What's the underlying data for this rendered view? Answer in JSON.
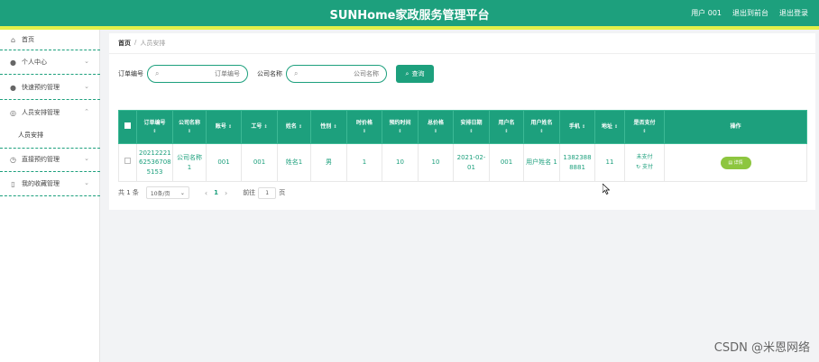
{
  "header": {
    "title": "SUNHome家政服务管理平台",
    "user": "用户 001",
    "back_to_console": "退出到前台",
    "logout": "退出登录"
  },
  "sidebar": {
    "items": [
      {
        "label": "首页",
        "icon": "home-icon"
      },
      {
        "label": "个人中心",
        "icon": "user-icon"
      },
      {
        "label": "快速预约管理",
        "icon": "user-icon"
      },
      {
        "label": "人员安排管理",
        "icon": "user-gear-icon"
      },
      {
        "label": "人员安排"
      },
      {
        "label": "直接预约管理",
        "icon": "clock-icon"
      },
      {
        "label": "我的收藏管理",
        "icon": "phone-icon"
      }
    ]
  },
  "breadcrumb": {
    "home": "首页",
    "sep": "/",
    "current": "人员安排"
  },
  "search": {
    "order_label": "订单编号",
    "order_placeholder": "订单编号",
    "company_label": "公司名称",
    "company_placeholder": "公司名称",
    "button": "查询"
  },
  "table": {
    "headers": [
      "订单编号",
      "公司名称",
      "账号",
      "工号",
      "姓名",
      "性别",
      "时价格",
      "预约时间",
      "总价格",
      "安排日期",
      "用户名",
      "用户姓名",
      "手机",
      "地址",
      "是否支付",
      "操作"
    ],
    "rows": [
      {
        "order_no": "20212221 62536708 5153",
        "company": "公司名称 1",
        "account": "001",
        "job_no": "001",
        "name": "姓名1",
        "gender": "男",
        "hourly_price": "1",
        "booking_time": "10",
        "total_price": "10",
        "arrange_date": "2021-02- 01",
        "username": "001",
        "user_realname": "用户姓名 1",
        "phone": "1382388 8881",
        "address": "11",
        "paid_status": "未支付",
        "pay_link": "支付",
        "detail": "详情"
      }
    ]
  },
  "pagination": {
    "total": "共 1 条",
    "page_size": "10条/页",
    "current_page": "1",
    "goto_label": "前往",
    "goto_value": "1",
    "goto_suffix": "页"
  },
  "watermark": "CSDN @米恩网络",
  "colors": {
    "primary": "#1da07d",
    "stripe": "#e3f04a",
    "detail_button": "#8dc63f"
  }
}
